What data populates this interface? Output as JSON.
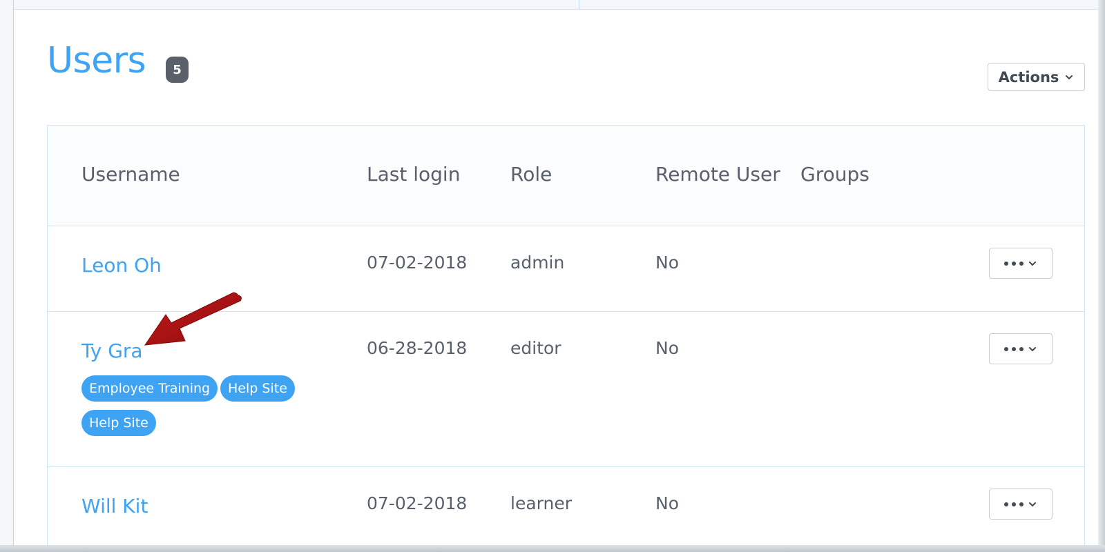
{
  "header": {
    "title": "Users",
    "count": "5",
    "actions_label": "Actions"
  },
  "table": {
    "columns": [
      "Username",
      "Last login",
      "Role",
      "Remote User",
      "Groups"
    ],
    "rows": [
      {
        "username": "Leon Oh",
        "last_login": "07-02-2018",
        "role": "admin",
        "remote_user": "No",
        "groups": []
      },
      {
        "username": "Ty Gra",
        "last_login": "06-28-2018",
        "role": "editor",
        "remote_user": "No",
        "groups": [
          "Employee Training",
          "Help Site",
          "Help Site"
        ]
      },
      {
        "username": "Will Kit",
        "last_login": "07-02-2018",
        "role": "learner",
        "remote_user": "No",
        "groups": []
      }
    ]
  },
  "colors": {
    "accent": "#3ea3f2",
    "text": "#58616b",
    "badge": "#5a6069",
    "border": "#cfe6f3",
    "arrow": "#b01010"
  },
  "icons": {
    "actions_chevron": "chevron-down-icon",
    "row_menu": "more-dots-icon",
    "annotation": "arrow-annotation-icon"
  }
}
